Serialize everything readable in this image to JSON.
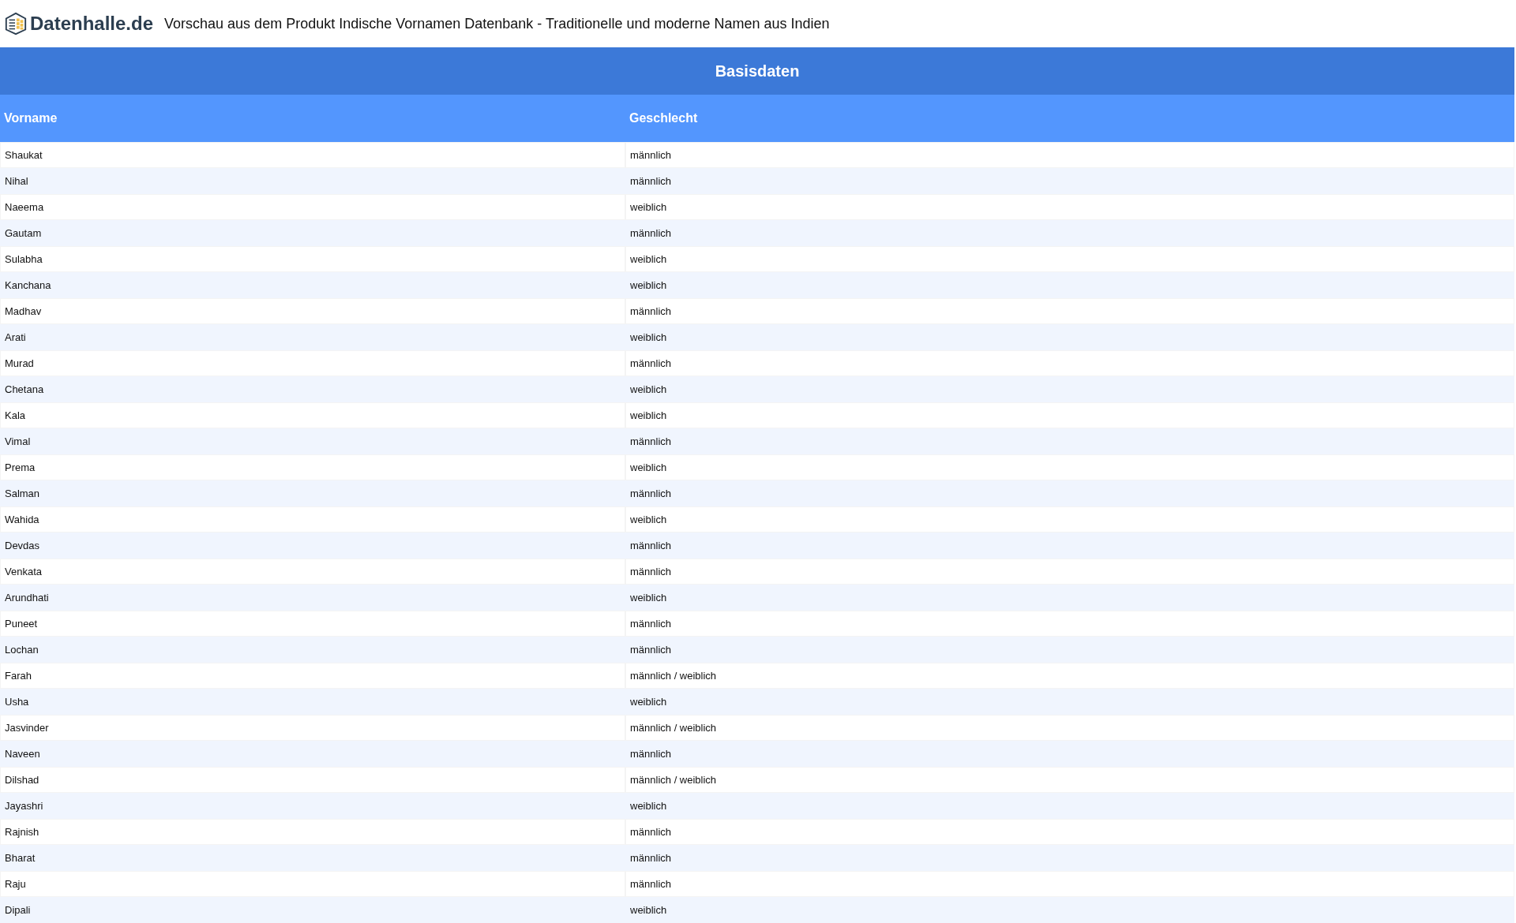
{
  "header": {
    "logo": "Datenhalle.de",
    "title": "Vorschau aus dem Produkt Indische Vornamen Datenbank - Traditionelle und moderne Namen aus Indien"
  },
  "table": {
    "caption": "Basisdaten",
    "columns": [
      "Vorname",
      "Geschlecht"
    ],
    "rows": [
      [
        "Shaukat",
        "männlich"
      ],
      [
        "Nihal",
        "männlich"
      ],
      [
        "Naeema",
        "weiblich"
      ],
      [
        "Gautam",
        "männlich"
      ],
      [
        "Sulabha",
        "weiblich"
      ],
      [
        "Kanchana",
        "weiblich"
      ],
      [
        "Madhav",
        "männlich"
      ],
      [
        "Arati",
        "weiblich"
      ],
      [
        "Murad",
        "männlich"
      ],
      [
        "Chetana",
        "weiblich"
      ],
      [
        "Kala",
        "weiblich"
      ],
      [
        "Vimal",
        "männlich"
      ],
      [
        "Prema",
        "weiblich"
      ],
      [
        "Salman",
        "männlich"
      ],
      [
        "Wahida",
        "weiblich"
      ],
      [
        "Devdas",
        "männlich"
      ],
      [
        "Venkata",
        "männlich"
      ],
      [
        "Arundhati",
        "weiblich"
      ],
      [
        "Puneet",
        "männlich"
      ],
      [
        "Lochan",
        "männlich"
      ],
      [
        "Farah",
        "männlich / weiblich"
      ],
      [
        "Usha",
        "weiblich"
      ],
      [
        "Jasvinder",
        "männlich / weiblich"
      ],
      [
        "Naveen",
        "männlich"
      ],
      [
        "Dilshad",
        "männlich / weiblich"
      ],
      [
        "Jayashri",
        "weiblich"
      ],
      [
        "Rajnish",
        "männlich"
      ],
      [
        "Bharat",
        "männlich"
      ],
      [
        "Raju",
        "männlich"
      ],
      [
        "Dipali",
        "weiblich"
      ]
    ]
  }
}
